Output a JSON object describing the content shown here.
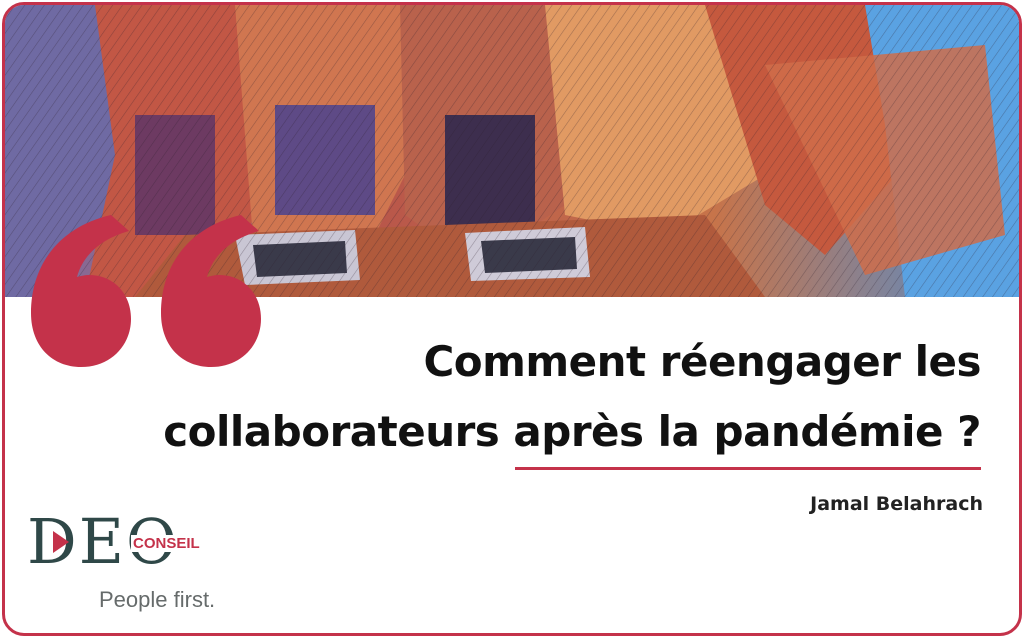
{
  "headline": {
    "line1": "Comment réengager les",
    "line2": "collaborateurs après la pandémie ?"
  },
  "author": "Jamal Belahrach",
  "logo": {
    "letters": "DEO",
    "sub": "CONSEIL",
    "tagline": "People first."
  },
  "colors": {
    "accent": "#c4324a",
    "logo_text": "#2f4848",
    "tagline": "#666b6b"
  },
  "icons": {
    "quote": "opening-quote-icon",
    "play": "play-triangle-icon"
  }
}
